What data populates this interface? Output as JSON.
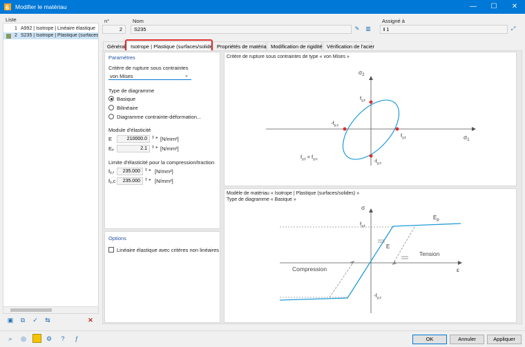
{
  "window": {
    "title": "Modifier le matériau",
    "minimize": "—",
    "maximize": "☐",
    "close": "✕"
  },
  "list": {
    "header": "Liste",
    "items": [
      {
        "num": "1",
        "label": "A992 | Isotrope | Linéaire élastique"
      },
      {
        "num": "2",
        "label": "S235 | Isotrope | Plastique (surfaces/s"
      }
    ],
    "delete_icon": "✕"
  },
  "top": {
    "no_label": "n°",
    "no_value": "2",
    "name_label": "Nom",
    "name_value": "S235",
    "assigned_label": "Assigné à",
    "assigned_value": "1",
    "assigned_prefix": "I"
  },
  "tabs": [
    "Général",
    "Isotrope | Plastique (surfaces/solides)",
    "Propriétés de matériau",
    "Modification de rigidité",
    "Vérification de l'acier"
  ],
  "params": {
    "title": "Paramètres",
    "criterion_label": "Critère de rupture sous contraintes",
    "criterion_value": "von Mises",
    "diagram_label": "Type de diagramme",
    "diagram_options": [
      "Basique",
      "Bilinéaire",
      "Diagramme contrainte-déformation..."
    ],
    "diagram_selected": 0,
    "modulus_label": "Module d'élasticité",
    "E_label": "E",
    "E_value": "210000.0",
    "E_unit": "[N/mm²]",
    "Ep_label": "Eₚ",
    "Ep_value": "2.1",
    "Ep_unit": "[N/mm²]",
    "limit_label": "Limite d'élasticité pour la compression/traction",
    "fyt_label": "fᵧ,ₜ",
    "fyt_value": "235.000",
    "fyt_unit": "[N/mm²]",
    "fyc_label": "fᵧ,c",
    "fyc_value": "235.000",
    "fyc_unit": "[N/mm²]"
  },
  "options": {
    "title": "Options",
    "checkbox_label": "Linéaire élastique avec critères non linéaires"
  },
  "diagram1": {
    "caption": "Critère de rupture sous contraintes de type « von Mises »",
    "sigma2": "σ",
    "sigma2_sub": "2",
    "sigma1": "σ",
    "sigma1_sub": "1",
    "fyt_top": "f",
    "fyt_top_sub": "y,t",
    "fyc_left": "-f",
    "fyc_left_sub": "y,c",
    "fyt_right": "f",
    "fyt_right_sub": "y,t",
    "fyc_bottom": "-f",
    "fyc_bottom_sub": "y,c",
    "eq_left": "f",
    "eq_left_sub": "y,t",
    "eq_mid": " = f",
    "eq_right_sub": "y,c"
  },
  "diagram2": {
    "caption1": "Modèle de matériau « Isotrope | Plastique (surfaces/solides) »",
    "caption2": "Type de diagramme « Basique »",
    "sigma": "σ",
    "eps": "ε",
    "fyt": "f",
    "fyt_sub": "y,t",
    "fyc": "-f",
    "fyc_sub": "y,c",
    "E": "E",
    "Ep": "E",
    "Ep_sub": "p",
    "tension": "Tension",
    "compression": "Compression"
  },
  "footer": {
    "ok": "OK",
    "cancel": "Annuler",
    "apply": "Appliquer"
  },
  "colors": {
    "accent": "#0078d7",
    "curve": "#1e9bd7",
    "points": "#d9302c",
    "highlight": "#e03030"
  }
}
